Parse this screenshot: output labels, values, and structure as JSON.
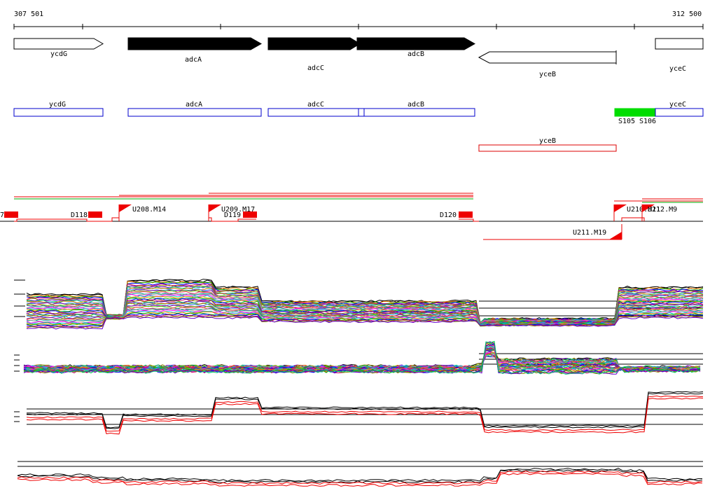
{
  "axis": {
    "start_label": "307 501",
    "end_label": "312 500"
  },
  "genes": [
    {
      "name": "ycdG",
      "strand": "+",
      "filled": false
    },
    {
      "name": "adcA",
      "strand": "+",
      "filled": true
    },
    {
      "name": "adcC",
      "strand": "+",
      "filled": true
    },
    {
      "name": "adcB",
      "strand": "+",
      "filled": true
    },
    {
      "name": "yceB",
      "strand": "-",
      "filled": false
    },
    {
      "name": "yceC",
      "strand": "+",
      "filled": false
    }
  ],
  "annotation_boxes": [
    {
      "name": "ycdG",
      "color": "#0000cc"
    },
    {
      "name": "adcA",
      "color": "#0000cc"
    },
    {
      "name": "adcC",
      "color": "#0000cc"
    },
    {
      "name": "adcB",
      "color": "#0000cc"
    },
    {
      "name": "yceC",
      "color": "#0000cc"
    },
    {
      "name": "yceB",
      "color": "#dd0000"
    }
  ],
  "green_region": {
    "labels": [
      "S105",
      "S106"
    ],
    "color": "#00dd00"
  },
  "features": {
    "down_labels": [
      "D118",
      "D119",
      "D120"
    ],
    "up_labels": [
      "U208.M14",
      "U209.M17",
      "U210.M11",
      "U212.M9"
    ],
    "reverse_labels": [
      "U211.M19"
    ],
    "edge_label": "7"
  },
  "colors": {
    "red": "#ee0000",
    "green": "#00aa00",
    "blue": "#0000cc",
    "black": "#000000"
  }
}
